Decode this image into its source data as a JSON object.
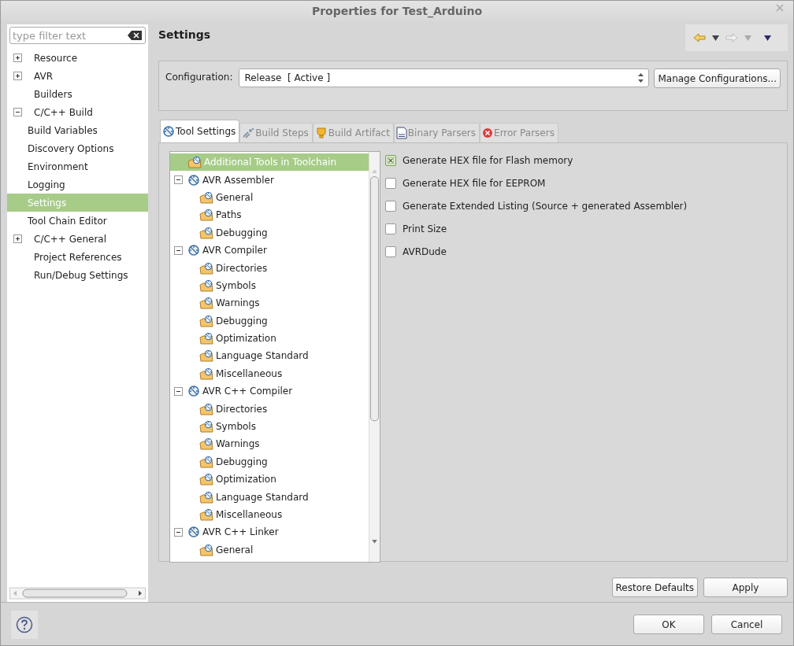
{
  "window": {
    "title": "Properties for Test_Arduino"
  },
  "filter": {
    "placeholder": "type filter text"
  },
  "nav": [
    {
      "label": "Resource",
      "kind": "expandable",
      "expanded": false,
      "selected": false
    },
    {
      "label": "AVR",
      "kind": "expandable",
      "expanded": false,
      "selected": false
    },
    {
      "label": "Builders",
      "kind": "leaf",
      "selected": false
    },
    {
      "label": "C/C++ Build",
      "kind": "expandable",
      "expanded": true,
      "selected": false,
      "children": [
        {
          "label": "Build Variables",
          "selected": false
        },
        {
          "label": "Discovery Options",
          "selected": false
        },
        {
          "label": "Environment",
          "selected": false
        },
        {
          "label": "Logging",
          "selected": false
        },
        {
          "label": "Settings",
          "selected": true
        },
        {
          "label": "Tool Chain Editor",
          "selected": false
        }
      ]
    },
    {
      "label": "C/C++ General",
      "kind": "expandable",
      "expanded": false,
      "selected": false
    },
    {
      "label": "Project References",
      "kind": "leaf",
      "selected": false
    },
    {
      "label": "Run/Debug Settings",
      "kind": "leaf",
      "selected": false
    }
  ],
  "page_title": "Settings",
  "toolbar": {
    "back_disabled": false,
    "forward_disabled": true
  },
  "configuration": {
    "label": "Configuration:",
    "value": "Release  [ Active ]",
    "button": "Manage Configurations..."
  },
  "tabs": [
    {
      "label": "Tool Settings",
      "kind": "tool",
      "selected": true
    },
    {
      "label": "Build Steps",
      "kind": "steps",
      "selected": false
    },
    {
      "label": "Build Artifact",
      "kind": "artifact",
      "selected": false
    },
    {
      "label": "Binary Parsers",
      "kind": "binary",
      "selected": false
    },
    {
      "label": "Error Parsers",
      "kind": "error",
      "selected": false
    }
  ],
  "tool_tree": [
    {
      "label": "Additional Tools in Toolchain",
      "kind": "option",
      "selected": true
    },
    {
      "label": "AVR Assembler",
      "kind": "tool",
      "selected": false,
      "expanded": true,
      "children": [
        {
          "label": "General",
          "kind": "option",
          "selected": false
        },
        {
          "label": "Paths",
          "kind": "option",
          "selected": false
        },
        {
          "label": "Debugging",
          "kind": "option",
          "selected": false
        }
      ]
    },
    {
      "label": "AVR Compiler",
      "kind": "tool",
      "selected": false,
      "expanded": true,
      "children": [
        {
          "label": "Directories",
          "kind": "option",
          "selected": false
        },
        {
          "label": "Symbols",
          "kind": "option",
          "selected": false
        },
        {
          "label": "Warnings",
          "kind": "option",
          "selected": false
        },
        {
          "label": "Debugging",
          "kind": "option",
          "selected": false
        },
        {
          "label": "Optimization",
          "kind": "option",
          "selected": false
        },
        {
          "label": "Language Standard",
          "kind": "option",
          "selected": false
        },
        {
          "label": "Miscellaneous",
          "kind": "option",
          "selected": false
        }
      ]
    },
    {
      "label": "AVR C++ Compiler",
      "kind": "tool",
      "selected": false,
      "expanded": true,
      "children": [
        {
          "label": "Directories",
          "kind": "option",
          "selected": false
        },
        {
          "label": "Symbols",
          "kind": "option",
          "selected": false
        },
        {
          "label": "Warnings",
          "kind": "option",
          "selected": false
        },
        {
          "label": "Debugging",
          "kind": "option",
          "selected": false
        },
        {
          "label": "Optimization",
          "kind": "option",
          "selected": false
        },
        {
          "label": "Language Standard",
          "kind": "option",
          "selected": false
        },
        {
          "label": "Miscellaneous",
          "kind": "option",
          "selected": false
        }
      ]
    },
    {
      "label": "AVR C++ Linker",
      "kind": "tool",
      "selected": false,
      "expanded": true,
      "children": [
        {
          "label": "General",
          "kind": "option",
          "selected": false
        }
      ]
    }
  ],
  "options": [
    {
      "label": "Generate HEX file for Flash memory",
      "checked": true
    },
    {
      "label": "Generate HEX file for EEPROM",
      "checked": false
    },
    {
      "label": "Generate Extended Listing (Source + generated Assembler)",
      "checked": false
    },
    {
      "label": "Print Size",
      "checked": false
    },
    {
      "label": "AVRDude",
      "checked": false
    }
  ],
  "page_buttons": [
    "Restore Defaults",
    "Apply"
  ],
  "dialog_buttons": [
    "OK",
    "Cancel"
  ]
}
